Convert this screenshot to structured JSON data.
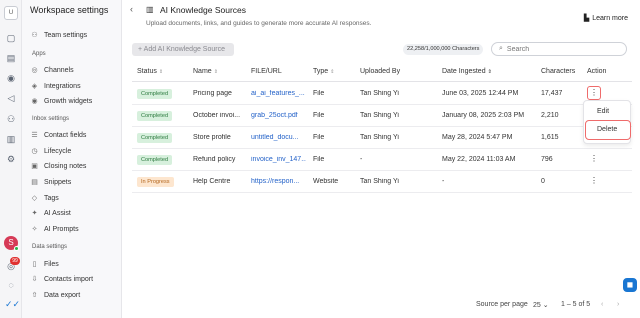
{
  "rail": {
    "workspace_initial": "U",
    "user_initial": "S",
    "notification_count": "99",
    "icons": [
      "inbox-icon",
      "contacts-icon",
      "broadcast-icon",
      "workflow-icon",
      "reports-icon",
      "settings-icon",
      "help-icon"
    ]
  },
  "sidebar": {
    "title": "Workspace settings",
    "top_item": "Team settings",
    "sections": [
      {
        "label": "Apps",
        "items": [
          "Channels",
          "Integrations",
          "Growth widgets"
        ]
      },
      {
        "label": "Inbox settings",
        "items": [
          "Contact fields",
          "Lifecycle",
          "Closing notes",
          "Snippets",
          "Tags",
          "AI Assist",
          "AI Prompts"
        ]
      },
      {
        "label": "Data settings",
        "items": [
          "Files",
          "Contacts import",
          "Data export"
        ]
      }
    ]
  },
  "header": {
    "title": "AI Knowledge Sources",
    "subtitle": "Upload documents, links, and guides to generate more accurate AI responses.",
    "learn_more": "Learn more"
  },
  "toolbar": {
    "add_button": "+ Add AI Knowledge Source",
    "characters_used": "22,258/1,000,000 Characters",
    "search_placeholder": "Search"
  },
  "table": {
    "columns": [
      "Status",
      "Name",
      "FILE/URL",
      "Type",
      "Uploaded By",
      "Date Ingested",
      "Characters",
      "Action"
    ],
    "rows": [
      {
        "status": "Completed",
        "name": "Pricing page",
        "file": "ai_ai_features_...",
        "type": "File",
        "by": "Tan Shing Yi",
        "date": "June 03, 2025 12:44 PM",
        "chars": "17,437"
      },
      {
        "status": "Completed",
        "name": "October invoi...",
        "file": "grab_25oct.pdf",
        "type": "File",
        "by": "Tan Shing Yi",
        "date": "January 08, 2025 2:03 PM",
        "chars": "2,210"
      },
      {
        "status": "Completed",
        "name": "Store profile",
        "file": "untitled_docu...",
        "type": "File",
        "by": "Tan Shing Yi",
        "date": "May 28, 2024 5:47 PM",
        "chars": "1,615"
      },
      {
        "status": "Completed",
        "name": "Refund policy",
        "file": "invoice_inv_147...",
        "type": "File",
        "by": "-",
        "date": "May 22, 2024 11:03 AM",
        "chars": "796"
      },
      {
        "status": "In Progress",
        "name": "Help Centre",
        "file": "https://respon...",
        "type": "Website",
        "by": "Tan Shing Yi",
        "date": "-",
        "chars": "0"
      }
    ]
  },
  "action_menu": {
    "edit": "Edit",
    "delete": "Delete"
  },
  "pagination": {
    "per_page_label": "Source per page",
    "per_page_value": "25",
    "range": "1 – 5 of 5"
  },
  "colors": {
    "accent": "#2563c9",
    "completed_bg": "#d7f0dd",
    "progress_bg": "#fde6cf",
    "danger": "#ef6b6b"
  }
}
